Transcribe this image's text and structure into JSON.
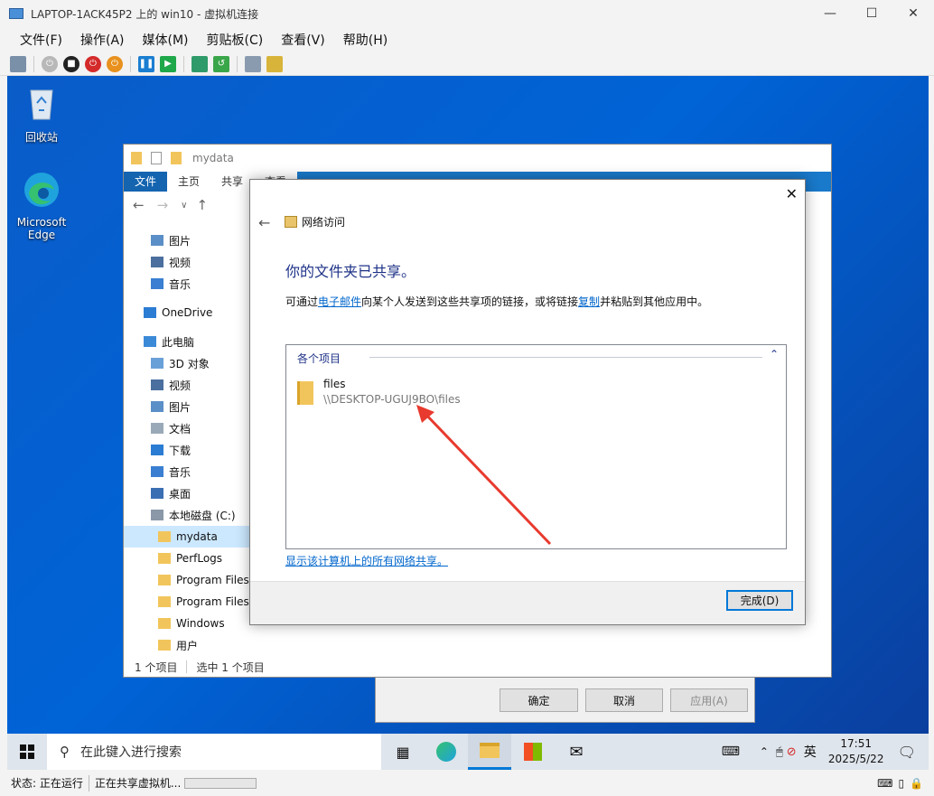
{
  "host": {
    "title": "LAPTOP-1ACK45P2 上的 win10 - 虚拟机连接",
    "menu": [
      "文件(F)",
      "操作(A)",
      "媒体(M)",
      "剪贴板(C)",
      "查看(V)",
      "帮助(H)"
    ],
    "status_label": "状态: 正在运行",
    "status_task": "正在共享虚拟机..."
  },
  "desktop": {
    "recycle_bin": "回收站",
    "edge": "Microsoft Edge"
  },
  "explorer": {
    "title": "mydata",
    "ribbon": [
      "文件",
      "主页",
      "共享",
      "查看"
    ],
    "nav": [
      {
        "label": "图片",
        "icon": "picture-icon",
        "indent": 1
      },
      {
        "label": "视频",
        "icon": "video-icon",
        "indent": 1
      },
      {
        "label": "音乐",
        "icon": "music-icon",
        "indent": 1
      },
      {
        "label": "OneDrive",
        "icon": "cloud-icon",
        "indent": 0
      },
      {
        "label": "此电脑",
        "icon": "pc-icon",
        "indent": 0
      },
      {
        "label": "3D 对象",
        "icon": "3d-icon",
        "indent": 1
      },
      {
        "label": "视频",
        "icon": "video-icon",
        "indent": 1
      },
      {
        "label": "图片",
        "icon": "picture-icon",
        "indent": 1
      },
      {
        "label": "文档",
        "icon": "document-icon",
        "indent": 1
      },
      {
        "label": "下载",
        "icon": "download-icon",
        "indent": 1
      },
      {
        "label": "音乐",
        "icon": "music-icon",
        "indent": 1
      },
      {
        "label": "桌面",
        "icon": "desktop-icon",
        "indent": 1
      },
      {
        "label": "本地磁盘 (C:)",
        "icon": "drive-icon",
        "indent": 1
      },
      {
        "label": "mydata",
        "icon": "folder-icon",
        "indent": 2
      },
      {
        "label": "PerfLogs",
        "icon": "folder-icon",
        "indent": 2
      },
      {
        "label": "Program Files",
        "icon": "folder-icon",
        "indent": 2
      },
      {
        "label": "Program Files",
        "icon": "folder-icon",
        "indent": 2
      },
      {
        "label": "Windows",
        "icon": "folder-icon",
        "indent": 2
      },
      {
        "label": "用户",
        "icon": "folder-icon",
        "indent": 2
      }
    ],
    "status_count": "1 个项目",
    "status_selected": "选中 1 个项目"
  },
  "props_dialog": {
    "ok": "确定",
    "cancel": "取消",
    "apply": "应用(A)"
  },
  "share_dialog": {
    "header": "网络访问",
    "heading": "你的文件夹已共享。",
    "desc_pre": "可通过",
    "desc_link1": "电子邮件",
    "desc_mid": "向某个人发送到这些共享项的链接，或将链接",
    "desc_link2": "复制",
    "desc_post": "并粘贴到其他应用中。",
    "items_header": "各个项目",
    "file_name": "files",
    "file_path": "\\\\DESKTOP-UGUJ9BO\\files",
    "show_all": "显示该计算机上的所有网络共享。",
    "done": "完成(D)"
  },
  "taskbar": {
    "search_placeholder": "在此键入进行搜索",
    "ime": "英",
    "time": "17:51",
    "date": "2025/5/22"
  }
}
